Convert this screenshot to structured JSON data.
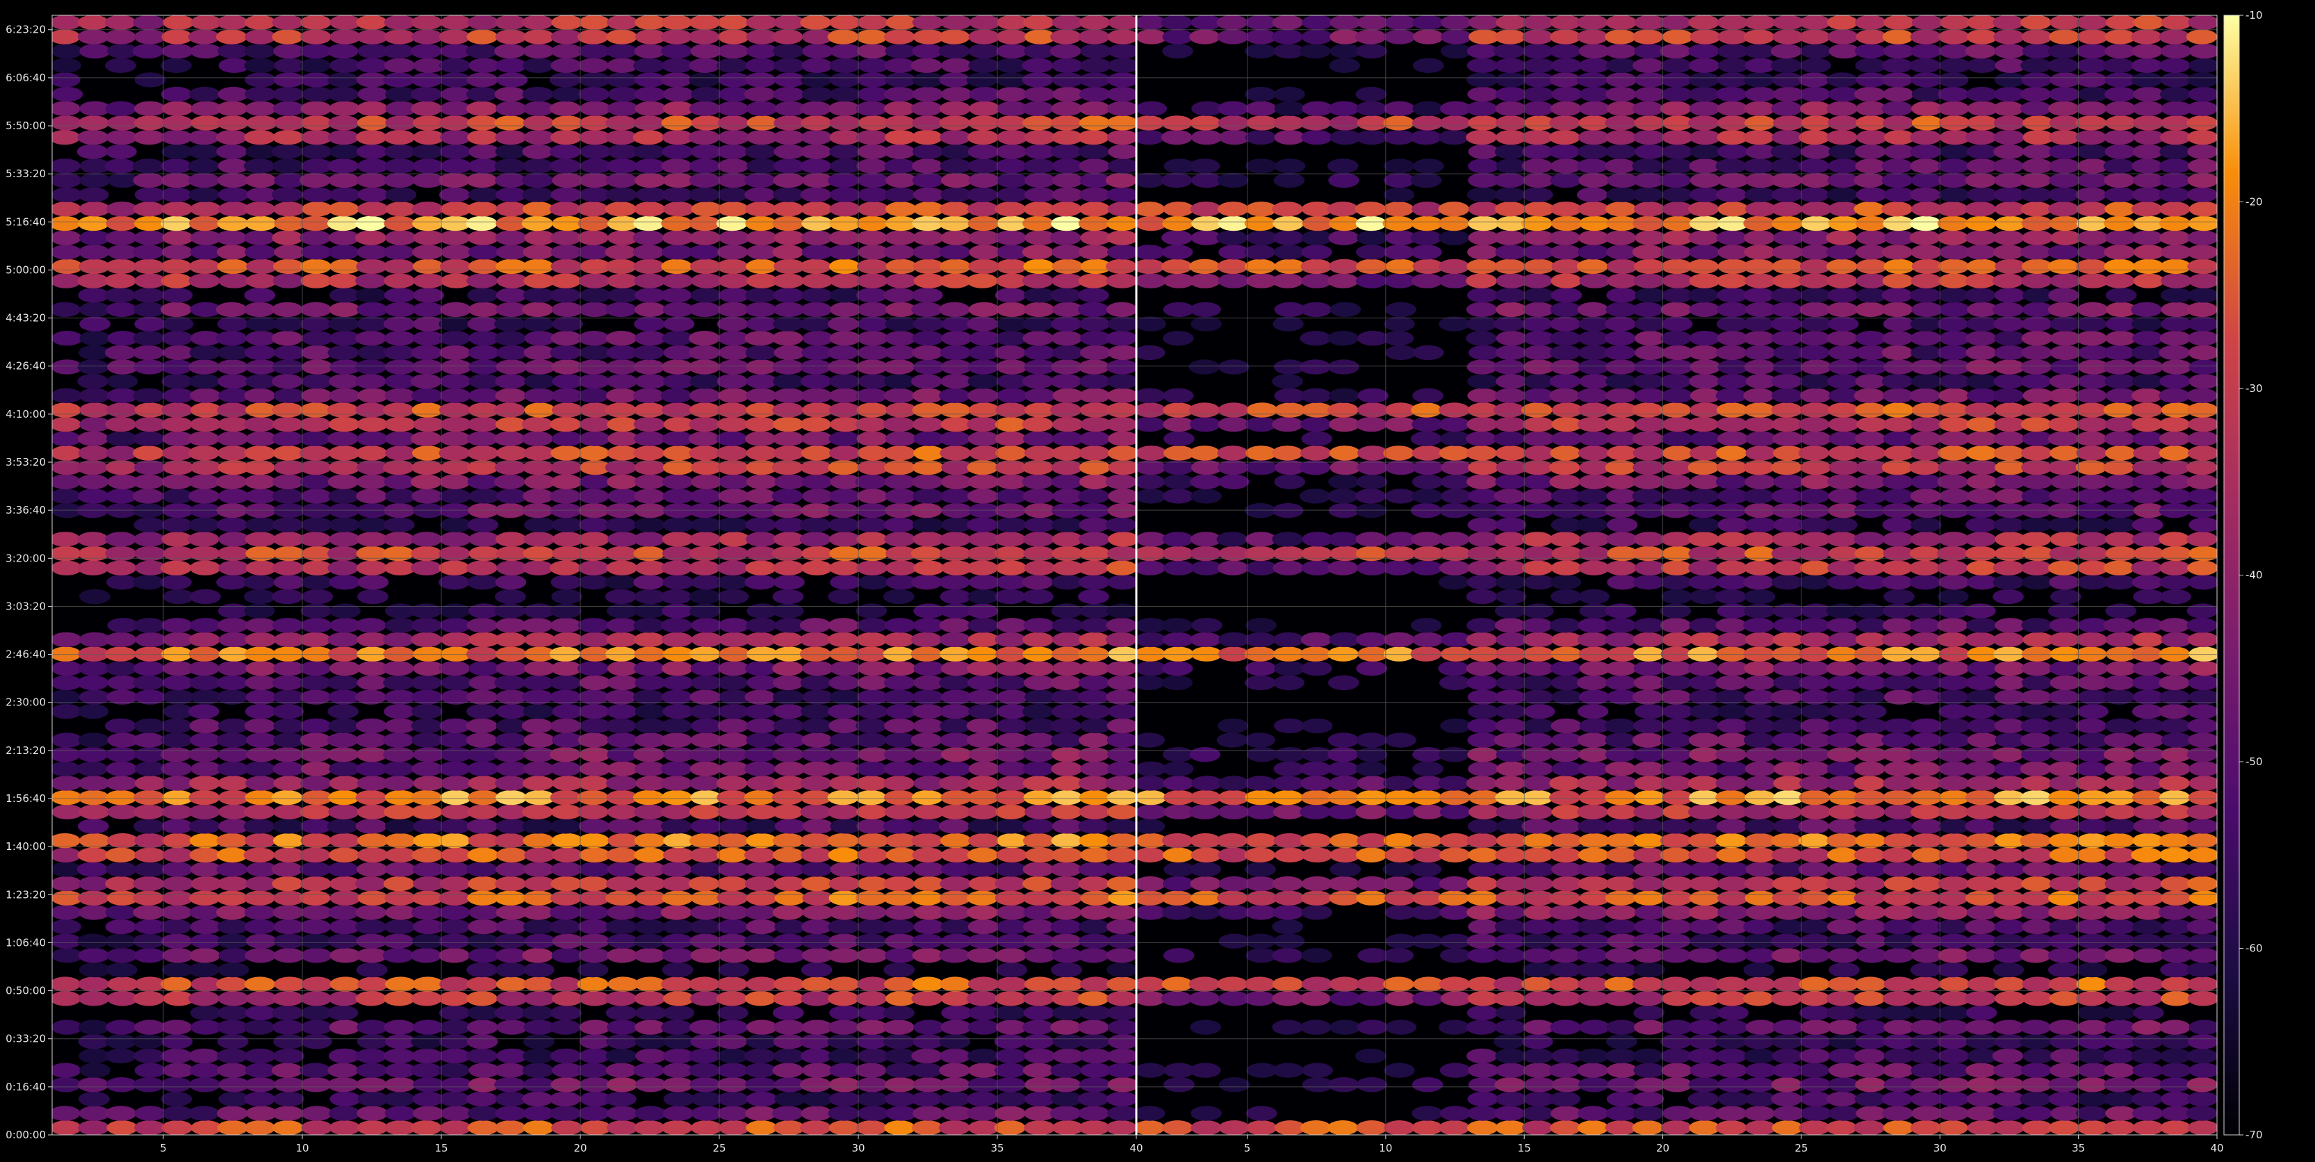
{
  "chart_data": {
    "type": "heatmap",
    "title": "",
    "xlabel": "",
    "ylabel": "",
    "panels": [
      {
        "name": "",
        "xlim": [
          1,
          40
        ],
        "x_ticks": [
          "5",
          "10",
          "15",
          "20",
          "25",
          "30",
          "35",
          "40"
        ]
      },
      {
        "name": "",
        "xlim": [
          1,
          40
        ],
        "x_ticks": [
          "5",
          "10",
          "15",
          "20",
          "25",
          "30",
          "35",
          "40"
        ]
      }
    ],
    "y_ticks": [
      "0:00:00",
      "0:16:40",
      "0:33:20",
      "0:50:00",
      "1:06:40",
      "1:23:20",
      "1:40:00",
      "1:56:40",
      "2:13:20",
      "2:30:00",
      "2:46:40",
      "3:03:20",
      "3:20:00",
      "3:36:40",
      "3:53:20",
      "4:10:00",
      "4:26:40",
      "4:43:20",
      "5:00:00",
      "5:16:40",
      "5:33:20",
      "5:50:00",
      "6:06:40",
      "6:23:20"
    ],
    "y_range_seconds": [
      0,
      23300
    ],
    "colorbar": {
      "range": [
        -70,
        -10
      ],
      "ticks": [
        "-10",
        "-20",
        "-30",
        "-40",
        "-50",
        "-60",
        "-70"
      ]
    },
    "colormap": "inferno",
    "grid": true,
    "strong_band_times": [
      "0:00:00",
      "0:50:00",
      "1:23:20",
      "1:40:00",
      "1:56:40",
      "2:46:40",
      "3:20:00",
      "3:53:20",
      "4:10:00",
      "5:00:00",
      "5:16:40",
      "5:50:00",
      "6:23:20"
    ],
    "colors": {
      "background": "#000000",
      "grid": "#5a5a5a",
      "text": "#e6e6e6"
    }
  }
}
